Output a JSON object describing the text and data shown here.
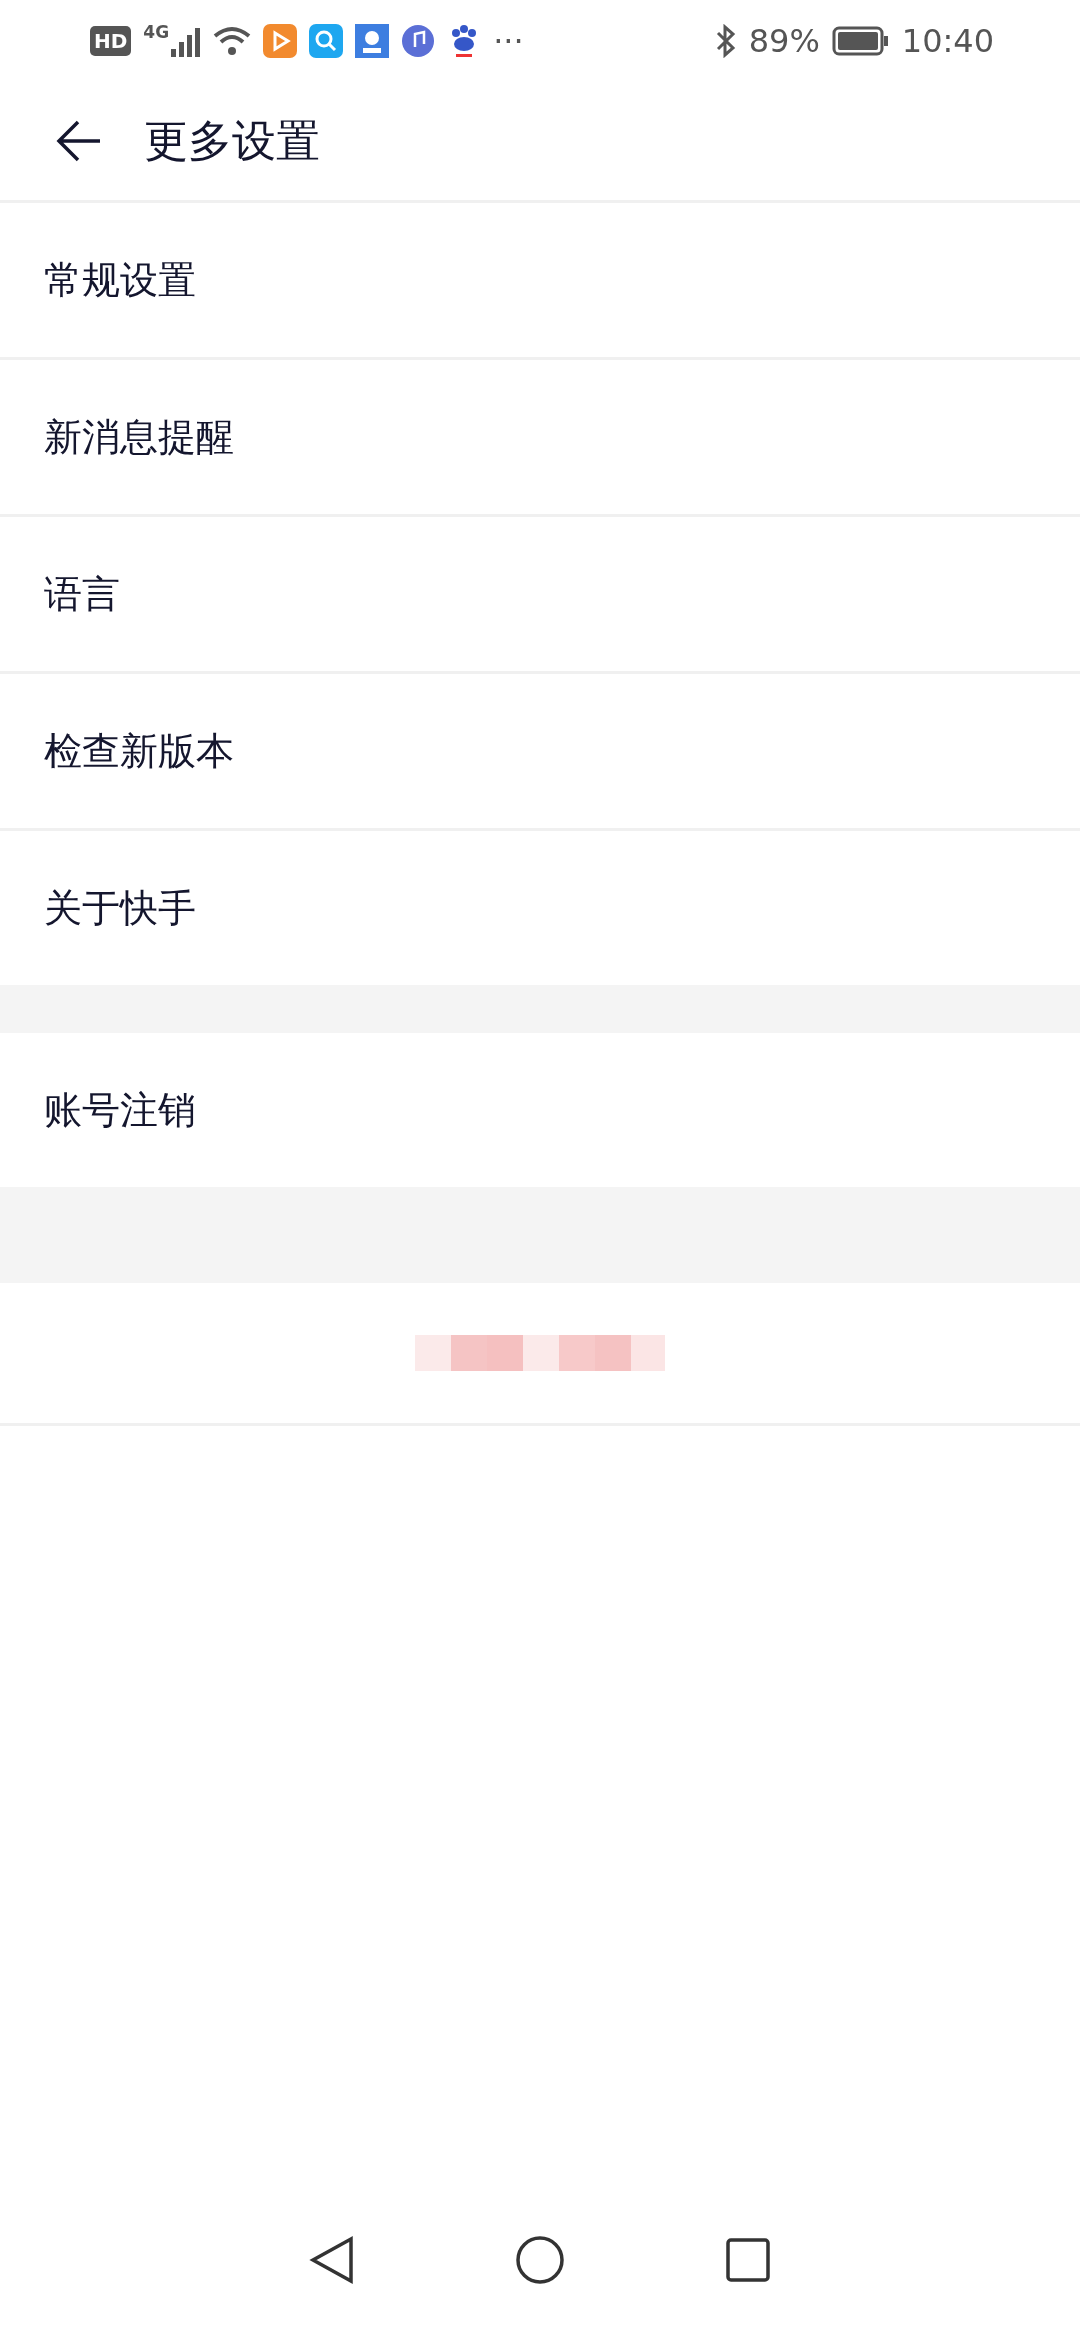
{
  "status_bar": {
    "badges": [
      "HD",
      "4G"
    ],
    "more": "···",
    "battery": "89%",
    "time": "10:40"
  },
  "header": {
    "title": "更多设置"
  },
  "groups": [
    {
      "items": [
        "常规设置",
        "新消息提醒",
        "语言",
        "检查新版本",
        "关于快手"
      ]
    },
    {
      "items": [
        "账号注销"
      ]
    }
  ]
}
